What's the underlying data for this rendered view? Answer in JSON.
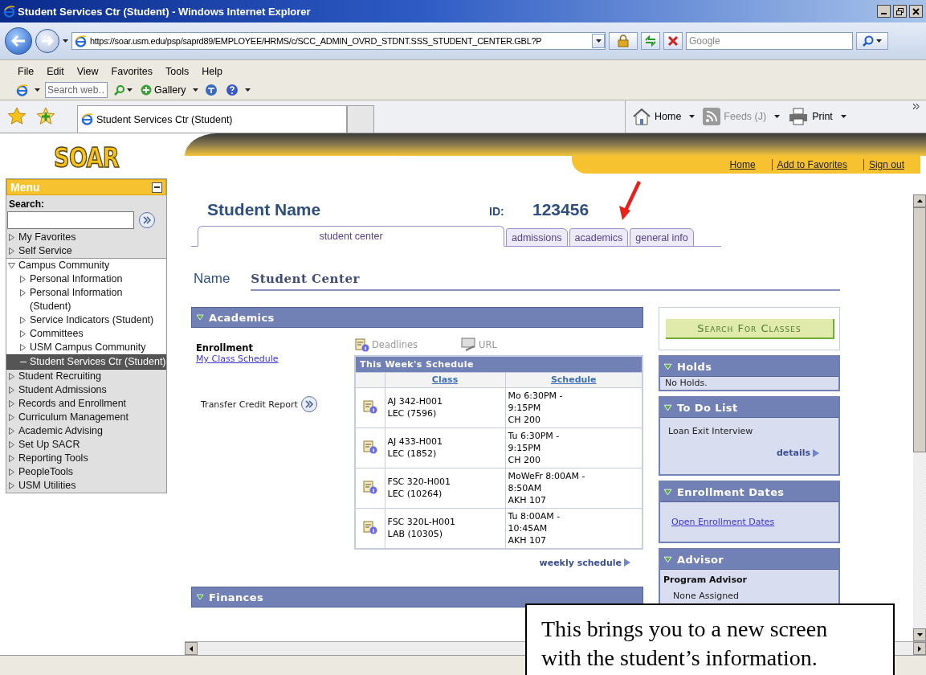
{
  "window": {
    "title": "Student Services Ctr (Student) - Windows Internet Explorer"
  },
  "address_bar": {
    "url": "https://soar.usm.edu/psp/saprd89/EMPLOYEE/HRMS/c/SCC_ADMIN_OVRD_STDNT.SSS_STUDENT_CENTER.GBL?P"
  },
  "web_search": {
    "placeholder": "Google"
  },
  "menu_bar": [
    "File",
    "Edit",
    "View",
    "Favorites",
    "Tools",
    "Help"
  ],
  "toolbar": {
    "search_placeholder": "Search web…",
    "gallery": "Gallery"
  },
  "favorites_bar": {
    "tab": "Student Services Ctr (Student)",
    "commands": [
      {
        "label": "Home",
        "disabled": false
      },
      {
        "label": "Feeds (J)",
        "disabled": true
      },
      {
        "label": "Print",
        "disabled": false
      }
    ]
  },
  "header": {
    "logo": "SOAR",
    "links": [
      "Home",
      "Add to Favorites",
      "Sign out"
    ]
  },
  "sidebar": {
    "title": "Menu",
    "search_label": "Search:",
    "items": [
      {
        "label": "My Favorites",
        "expanded": false,
        "selected": false
      },
      {
        "label": "Self Service",
        "expanded": false,
        "selected": false
      },
      {
        "label": "Campus Community",
        "expanded": true,
        "selected": false,
        "children": [
          {
            "label": "Personal Information",
            "expanded": false,
            "selected": false
          },
          {
            "label": "Personal Information (Student)",
            "expanded": false,
            "selected": false
          },
          {
            "label": "Service Indicators (Student)",
            "expanded": false,
            "selected": false
          },
          {
            "label": "Committees",
            "expanded": false,
            "selected": false
          },
          {
            "label": "USM Campus Community",
            "expanded": false,
            "selected": false
          },
          {
            "label": "Student Services Ctr (Student)",
            "selected": true
          }
        ]
      },
      {
        "label": "Student Recruiting",
        "expanded": false,
        "selected": false
      },
      {
        "label": "Student Admissions",
        "expanded": false,
        "selected": false
      },
      {
        "label": "Records and Enrollment",
        "expanded": false,
        "selected": false
      },
      {
        "label": "Curriculum Management",
        "expanded": false,
        "selected": false
      },
      {
        "label": "Academic Advising",
        "expanded": false,
        "selected": false
      },
      {
        "label": "Set Up SACR",
        "expanded": false,
        "selected": false
      },
      {
        "label": "Reporting Tools",
        "expanded": false,
        "selected": false
      },
      {
        "label": "PeopleTools",
        "expanded": false,
        "selected": false
      },
      {
        "label": "USM Utilities",
        "expanded": false,
        "selected": false
      }
    ]
  },
  "student": {
    "name": "Student Name",
    "id_label": "ID:",
    "id": "123456"
  },
  "tabs": [
    {
      "label": "student center",
      "selected": true
    },
    {
      "label": "admissions",
      "selected": false
    },
    {
      "label": "academics",
      "selected": false
    },
    {
      "label": "general info",
      "selected": false
    }
  ],
  "page_title": {
    "label": "Name",
    "value": "Student Center"
  },
  "academics": {
    "title": "Academics",
    "expanded": true,
    "enrollment_label": "Enrollment",
    "schedule_link": "My Class Schedule",
    "transfer_link": "Transfer Credit Report",
    "deadlines": "Deadlines",
    "url": "URL",
    "schedule": {
      "title": "This Week's Schedule",
      "columns": [
        "Class",
        "Schedule"
      ],
      "rows": [
        {
          "class": [
            "AJ 342-H001",
            "LEC (7596)"
          ],
          "schedule": [
            "Mo 6:30PM -",
            "9:15PM",
            "CH 200"
          ]
        },
        {
          "class": [
            "AJ 433-H001",
            "LEC (1852)"
          ],
          "schedule": [
            "Tu 6:30PM -",
            "9:15PM",
            "CH 200"
          ]
        },
        {
          "class": [
            "FSC 320-H001",
            "LEC (10264)"
          ],
          "schedule": [
            "MoWeFr 8:00AM -",
            "8:50AM",
            "AKH 107"
          ]
        },
        {
          "class": [
            "FSC 320L-H001",
            "LAB (10305)"
          ],
          "schedule": [
            "Tu 8:00AM -",
            "10:45AM",
            "AKH 107"
          ]
        }
      ]
    },
    "weekly_link": "weekly schedule"
  },
  "finances": {
    "title": "Finances",
    "expanded": true
  },
  "search_button": "Search For Classes",
  "panels": [
    {
      "kind": "text",
      "title": "Holds",
      "expanded": true,
      "items": [
        "No Holds."
      ]
    },
    {
      "kind": "todo",
      "title": "To Do List",
      "expanded": true,
      "items": [
        "Loan Exit Interview"
      ],
      "link": "details"
    },
    {
      "kind": "link",
      "title": "Enrollment Dates",
      "expanded": true,
      "link": "Open Enrollment Dates"
    },
    {
      "kind": "advisor",
      "title": "Advisor",
      "expanded": true,
      "heading": "Program Advisor",
      "items": [
        "None Assigned"
      ]
    }
  ],
  "callout": {
    "lines": [
      "This brings you to a new screen",
      "with the student’s information."
    ]
  }
}
